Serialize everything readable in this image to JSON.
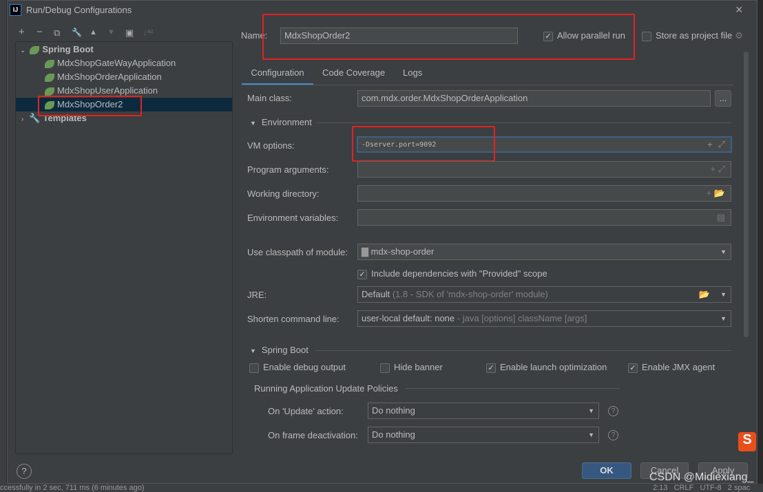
{
  "window": {
    "title": "Run/Debug Configurations",
    "logo": "IJ"
  },
  "toolbar": {
    "add": "+",
    "remove": "−",
    "copy": "⧉",
    "edit": "🔧",
    "up": "▲",
    "down": "▼",
    "folder": "▣",
    "sort": "↓ᵃᶻ"
  },
  "tree": {
    "group": "Spring Boot",
    "items": [
      "MdxShopGateWayApplication",
      "MdxShopOrderApplication",
      "MdxShopUserApplication",
      "MdxShopOrder2"
    ],
    "templates": "Templates"
  },
  "header": {
    "name_label": "Name:",
    "name_value": "MdxShopOrder2",
    "allow_parallel": "Allow parallel run",
    "store_project": "Store as project file"
  },
  "tabs": [
    "Configuration",
    "Code Coverage",
    "Logs"
  ],
  "form": {
    "main_class_label": "Main class:",
    "main_class": "com.mdx.order.MdxShopOrderApplication",
    "browse": "...",
    "environment": "Environment",
    "vm_label": "VM options:",
    "vm_value": "-Dserver.port=9092",
    "args_label": "Program arguments:",
    "wd_label": "Working directory:",
    "env_label": "Environment variables:",
    "cp_label": "Use classpath of module:",
    "cp_value": "mdx-shop-order",
    "include_deps": "Include dependencies with \"Provided\" scope",
    "jre_label": "JRE:",
    "jre_value": "Default",
    "jre_hint": "(1.8 - SDK of 'mdx-shop-order' module)",
    "shorten_label": "Shorten command line:",
    "shorten_value": "user-local default: none",
    "shorten_hint": "- java [options] className [args]"
  },
  "spring": {
    "title": "Spring Boot",
    "debug": "Enable debug output",
    "banner": "Hide banner",
    "launch": "Enable launch optimization",
    "jmx": "Enable JMX agent",
    "policies": "Running Application Update Policies",
    "update_label": "On 'Update' action:",
    "update_value": "Do nothing",
    "frame_label": "On frame deactivation:",
    "frame_value": "Do nothing"
  },
  "buttons": {
    "ok": "OK",
    "cancel": "Cancel",
    "apply": "Apply",
    "help": "?"
  },
  "watermark": "CSDN @Midiexiang_",
  "status": {
    "left": "ccessfully in 2 sec, 711 ms (6 minutes ago)",
    "right": "2:13   CRLF   UTF-8   2 spac"
  }
}
